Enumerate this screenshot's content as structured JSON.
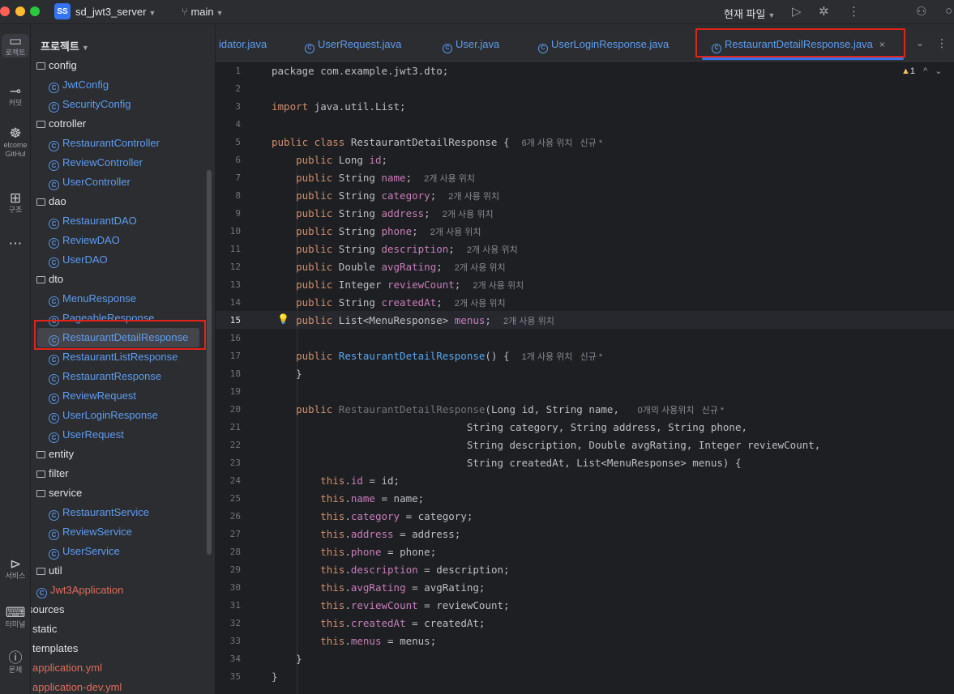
{
  "titlebar": {
    "project_badge": "SS",
    "project_name": "sd_jwt3_server",
    "branch": "main",
    "run_config": "현재 파일"
  },
  "toolstrip": [
    {
      "icon": "folder-icon",
      "label": "로젝트"
    },
    {
      "icon": "commit-icon",
      "label": "커밋"
    },
    {
      "icon": "github-icon",
      "label": "elcome\nGitHul"
    },
    {
      "icon": "structure-icon",
      "label": "구조"
    },
    {
      "icon": "more-icon",
      "label": "..."
    },
    {
      "icon": "services-icon",
      "label": "서비스"
    },
    {
      "icon": "terminal-icon",
      "label": "터미널"
    },
    {
      "icon": "problems-icon",
      "label": "문제"
    }
  ],
  "project_panel": {
    "header": "프로젝트",
    "tree": [
      {
        "label": "config",
        "kind": "folder",
        "indent": 0
      },
      {
        "label": "JwtConfig",
        "kind": "class",
        "indent": 1
      },
      {
        "label": "SecurityConfig",
        "kind": "class",
        "indent": 1
      },
      {
        "label": "cotroller",
        "kind": "folder",
        "indent": 0
      },
      {
        "label": "RestaurantController",
        "kind": "class",
        "indent": 1
      },
      {
        "label": "ReviewController",
        "kind": "class",
        "indent": 1
      },
      {
        "label": "UserController",
        "kind": "class",
        "indent": 1
      },
      {
        "label": "dao",
        "kind": "folder",
        "indent": 0
      },
      {
        "label": "RestaurantDAO",
        "kind": "class",
        "indent": 1
      },
      {
        "label": "ReviewDAO",
        "kind": "class",
        "indent": 1
      },
      {
        "label": "UserDAO",
        "kind": "class",
        "indent": 1
      },
      {
        "label": "dto",
        "kind": "folder",
        "indent": 0
      },
      {
        "label": "MenuResponse",
        "kind": "class",
        "indent": 1
      },
      {
        "label": "PageableResponse",
        "kind": "class",
        "indent": 1
      },
      {
        "label": "RestaurantDetailResponse",
        "kind": "class",
        "indent": 1,
        "selected": true
      },
      {
        "label": "RestaurantListResponse",
        "kind": "class",
        "indent": 1
      },
      {
        "label": "RestaurantResponse",
        "kind": "class",
        "indent": 1
      },
      {
        "label": "ReviewRequest",
        "kind": "class",
        "indent": 1
      },
      {
        "label": "UserLoginResponse",
        "kind": "class",
        "indent": 1
      },
      {
        "label": "UserRequest",
        "kind": "class",
        "indent": 1
      },
      {
        "label": "entity",
        "kind": "folder",
        "indent": 0
      },
      {
        "label": "filter",
        "kind": "folder",
        "indent": 0
      },
      {
        "label": "service",
        "kind": "folder",
        "indent": 0
      },
      {
        "label": "RestaurantService",
        "kind": "class",
        "indent": 1
      },
      {
        "label": "ReviewService",
        "kind": "class",
        "indent": 1
      },
      {
        "label": "UserService",
        "kind": "class",
        "indent": 1
      },
      {
        "label": "util",
        "kind": "folder",
        "indent": 0
      },
      {
        "label": "Jwt3Application",
        "kind": "app",
        "indent": 0
      },
      {
        "label": "sources",
        "kind": "plain",
        "indent": -1
      },
      {
        "label": "static",
        "kind": "plain",
        "indent": -0.5
      },
      {
        "label": "templates",
        "kind": "plain",
        "indent": -0.5
      },
      {
        "label": "application.yml",
        "kind": "yml",
        "indent": -0.5
      },
      {
        "label": "application-dev.yml",
        "kind": "yml",
        "indent": -0.5
      }
    ]
  },
  "tabs": [
    {
      "label": "idator.java",
      "icon": "none"
    },
    {
      "label": "UserRequest.java",
      "icon": "class-icon"
    },
    {
      "label": "User.java",
      "icon": "class-icon"
    },
    {
      "label": "UserLoginResponse.java",
      "icon": "class-icon"
    },
    {
      "label": "RestaurantDetailResponse.java",
      "icon": "class-icon",
      "active": true
    }
  ],
  "editor": {
    "warning_count": "1",
    "current_line": 15,
    "lines": [
      [
        [
          "",
          "package com.example.jwt3.dto;"
        ]
      ],
      [],
      [
        [
          "kw",
          "import"
        ],
        [
          "",
          " java.util.List;"
        ]
      ],
      [],
      [
        [
          "kw",
          "public class"
        ],
        [
          "",
          " RestaurantDetailResponse {  "
        ],
        [
          "hint",
          "6개 사용 위치   신규 *"
        ]
      ],
      [
        [
          "",
          "    "
        ],
        [
          "kw",
          "public"
        ],
        [
          "",
          " Long "
        ],
        [
          "fld",
          "id"
        ],
        [
          "",
          ";"
        ]
      ],
      [
        [
          "",
          "    "
        ],
        [
          "kw",
          "public"
        ],
        [
          "",
          " String "
        ],
        [
          "fld",
          "name"
        ],
        [
          "",
          ";  "
        ],
        [
          "hint",
          "2개 사용 위치"
        ]
      ],
      [
        [
          "",
          "    "
        ],
        [
          "kw",
          "public"
        ],
        [
          "",
          " String "
        ],
        [
          "fld",
          "category"
        ],
        [
          "",
          ";  "
        ],
        [
          "hint",
          "2개 사용 위치"
        ]
      ],
      [
        [
          "",
          "    "
        ],
        [
          "kw",
          "public"
        ],
        [
          "",
          " String "
        ],
        [
          "fld",
          "address"
        ],
        [
          "",
          ";  "
        ],
        [
          "hint",
          "2개 사용 위치"
        ]
      ],
      [
        [
          "",
          "    "
        ],
        [
          "kw",
          "public"
        ],
        [
          "",
          " String "
        ],
        [
          "fld",
          "phone"
        ],
        [
          "",
          ";  "
        ],
        [
          "hint",
          "2개 사용 위치"
        ]
      ],
      [
        [
          "",
          "    "
        ],
        [
          "kw",
          "public"
        ],
        [
          "",
          " String "
        ],
        [
          "fld",
          "description"
        ],
        [
          "",
          ";  "
        ],
        [
          "hint",
          "2개 사용 위치"
        ]
      ],
      [
        [
          "",
          "    "
        ],
        [
          "kw",
          "public"
        ],
        [
          "",
          " Double "
        ],
        [
          "fld",
          "avgRating"
        ],
        [
          "",
          ";  "
        ],
        [
          "hint",
          "2개 사용 위치"
        ]
      ],
      [
        [
          "",
          "    "
        ],
        [
          "kw",
          "public"
        ],
        [
          "",
          " Integer "
        ],
        [
          "fld",
          "reviewCount"
        ],
        [
          "",
          ";  "
        ],
        [
          "hint",
          "2개 사용 위치"
        ]
      ],
      [
        [
          "",
          "    "
        ],
        [
          "kw",
          "public"
        ],
        [
          "",
          " String "
        ],
        [
          "fld",
          "createdAt"
        ],
        [
          "",
          ";  "
        ],
        [
          "hint",
          "2개 사용 위치"
        ]
      ],
      [
        [
          "",
          "    "
        ],
        [
          "kw",
          "public"
        ],
        [
          "",
          " List<MenuResponse> "
        ],
        [
          "fld",
          "menus"
        ],
        [
          "",
          ";  "
        ],
        [
          "hint",
          "2개 사용 위치"
        ]
      ],
      [],
      [
        [
          "",
          "    "
        ],
        [
          "kw",
          "public"
        ],
        [
          "",
          " "
        ],
        [
          "mth",
          "RestaurantDetailResponse"
        ],
        [
          "",
          "() {  "
        ],
        [
          "hint",
          "1개 사용 위치   신규 *"
        ]
      ],
      [
        [
          "",
          "    }"
        ]
      ],
      [],
      [
        [
          "",
          "    "
        ],
        [
          "kw",
          "public"
        ],
        [
          "",
          " "
        ],
        [
          "mthu",
          "RestaurantDetailResponse"
        ],
        [
          "",
          "(Long id, String name,   "
        ],
        [
          "hint",
          "0개의 사용위치   신규 *"
        ]
      ],
      [
        [
          "",
          "                                String category, String address, String phone,"
        ]
      ],
      [
        [
          "",
          "                                String description, Double avgRating, Integer reviewCount,"
        ]
      ],
      [
        [
          "",
          "                                String createdAt, List<MenuResponse> menus) {"
        ]
      ],
      [
        [
          "",
          "        "
        ],
        [
          "kw",
          "this"
        ],
        [
          "",
          "."
        ],
        [
          "fld",
          "id"
        ],
        [
          "",
          " = id;"
        ]
      ],
      [
        [
          "",
          "        "
        ],
        [
          "kw",
          "this"
        ],
        [
          "",
          "."
        ],
        [
          "fld",
          "name"
        ],
        [
          "",
          " = name;"
        ]
      ],
      [
        [
          "",
          "        "
        ],
        [
          "kw",
          "this"
        ],
        [
          "",
          "."
        ],
        [
          "fld",
          "category"
        ],
        [
          "",
          " = category;"
        ]
      ],
      [
        [
          "",
          "        "
        ],
        [
          "kw",
          "this"
        ],
        [
          "",
          "."
        ],
        [
          "fld",
          "address"
        ],
        [
          "",
          " = address;"
        ]
      ],
      [
        [
          "",
          "        "
        ],
        [
          "kw",
          "this"
        ],
        [
          "",
          "."
        ],
        [
          "fld",
          "phone"
        ],
        [
          "",
          " = phone;"
        ]
      ],
      [
        [
          "",
          "        "
        ],
        [
          "kw",
          "this"
        ],
        [
          "",
          "."
        ],
        [
          "fld",
          "description"
        ],
        [
          "",
          " = description;"
        ]
      ],
      [
        [
          "",
          "        "
        ],
        [
          "kw",
          "this"
        ],
        [
          "",
          "."
        ],
        [
          "fld",
          "avgRating"
        ],
        [
          "",
          " = avgRating;"
        ]
      ],
      [
        [
          "",
          "        "
        ],
        [
          "kw",
          "this"
        ],
        [
          "",
          "."
        ],
        [
          "fld",
          "reviewCount"
        ],
        [
          "",
          " = reviewCount;"
        ]
      ],
      [
        [
          "",
          "        "
        ],
        [
          "kw",
          "this"
        ],
        [
          "",
          "."
        ],
        [
          "fld",
          "createdAt"
        ],
        [
          "",
          " = createdAt;"
        ]
      ],
      [
        [
          "",
          "        "
        ],
        [
          "kw",
          "this"
        ],
        [
          "",
          "."
        ],
        [
          "fld",
          "menus"
        ],
        [
          "",
          " = menus;"
        ]
      ],
      [
        [
          "",
          "    }"
        ]
      ],
      [
        [
          "",
          "}"
        ]
      ]
    ]
  },
  "colors": {
    "accent": "#3574f0",
    "highlight_box": "#e2231a",
    "keyword": "#cf8e6d",
    "field": "#c77dbb",
    "method": "#56a8f5"
  }
}
